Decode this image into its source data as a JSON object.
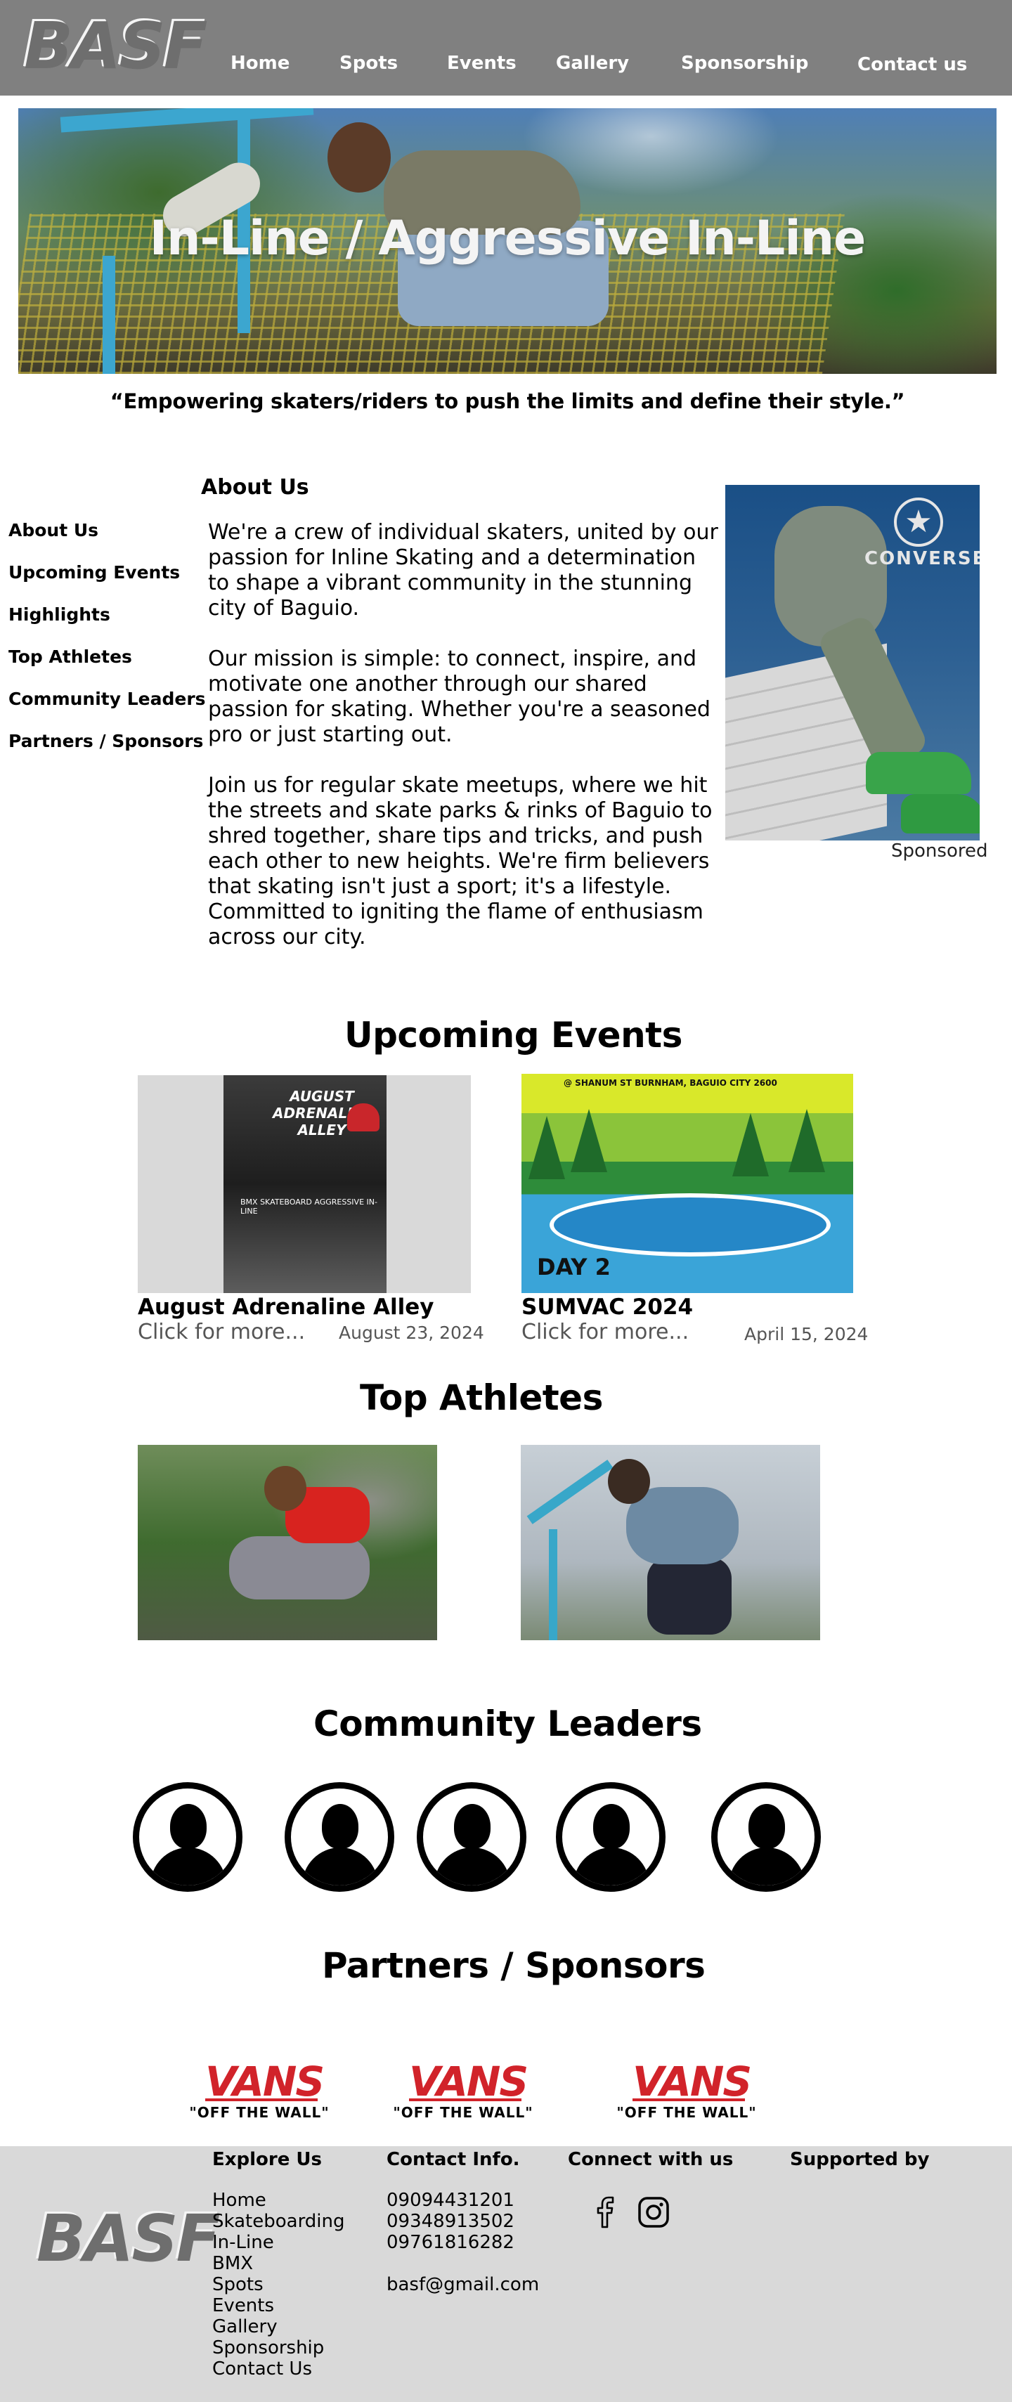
{
  "brand": {
    "logo": "BASF"
  },
  "nav": {
    "items": [
      {
        "label": "Home"
      },
      {
        "label": "Spots"
      },
      {
        "label": "Events"
      },
      {
        "label": "Gallery"
      },
      {
        "label": "Sponsorship"
      },
      {
        "label": "Contact us"
      }
    ]
  },
  "hero": {
    "title": "In-Line / Aggressive In-Line",
    "tagline": "“Empowering skaters/riders to push the limits and define their style.”"
  },
  "sidebar": {
    "items": [
      {
        "label": "About Us"
      },
      {
        "label": "Upcoming Events"
      },
      {
        "label": "Highlights"
      },
      {
        "label": "Top Athletes"
      },
      {
        "label": "Community Leaders"
      },
      {
        "label": "Partners / Sponsors"
      }
    ]
  },
  "about": {
    "heading": "About Us",
    "paragraphs": [
      "We're a crew of individual skaters, united by our passion for Inline Skating and a determination to shape a vibrant community in the stunning city of Baguio.",
      "Our mission is simple: to connect, inspire, and motivate one another through our shared passion for skating. Whether you're a seasoned pro or just starting out.",
      "Join us for regular skate meetups, where we hit the streets and skate parks & rinks of Baguio to shred together, share tips and tricks, and push each other to new heights. We're firm believers that skating isn't just a sport; it's a lifestyle. Committed to igniting the flame of enthusiasm across our city."
    ],
    "sponsor_ad": {
      "brand": "CONVERSE",
      "star": "★",
      "label": "Sponsored"
    }
  },
  "events": {
    "heading": "Upcoming Events",
    "items": [
      {
        "title": "August Adrenaline Alley",
        "more": "Click for more...",
        "date": "August 23, 2024",
        "poster_title": "AUGUST ADRENALINE ALLEY",
        "poster_categories": "BMX    SKATEBOARD    AGGRESSIVE IN-LINE"
      },
      {
        "title": "SUMVAC 2024",
        "more": "Click for more...",
        "date": "April 15, 2024",
        "poster_address": "@ SHANUM ST BURNHAM, BAGUIO CITY 2600",
        "poster_day": "DAY 2"
      }
    ]
  },
  "athletes": {
    "heading": "Top Athletes",
    "count": 2
  },
  "leaders": {
    "heading": "Community Leaders",
    "count": 5
  },
  "sponsors": {
    "heading": "Partners / Sponsors",
    "logos": [
      {
        "word": "VANS",
        "tag": "\"OFF THE WALL\""
      },
      {
        "word": "VANS",
        "tag": "\"OFF THE WALL\""
      },
      {
        "word": "VANS",
        "tag": "\"OFF THE WALL\""
      }
    ]
  },
  "footer": {
    "logo": "BASF",
    "explore": {
      "heading": "Explore Us",
      "links": [
        "Home",
        "Skateboarding",
        "In-Line",
        "BMX",
        "Spots",
        "Events",
        "Gallery",
        "Sponsorship",
        "Contact Us"
      ]
    },
    "contact": {
      "heading": "Contact Info.",
      "phones": [
        "09094431201",
        "09348913502",
        "09761816282"
      ],
      "email": "basf@gmail.com"
    },
    "connect": {
      "heading": "Connect with us",
      "icons": [
        "facebook-icon",
        "instagram-icon"
      ]
    },
    "supported": {
      "heading": "Supported by"
    }
  },
  "colors": {
    "header_bg": "#808080",
    "footer_bg": "#d9d9d9",
    "vans_red": "#d1232a"
  }
}
